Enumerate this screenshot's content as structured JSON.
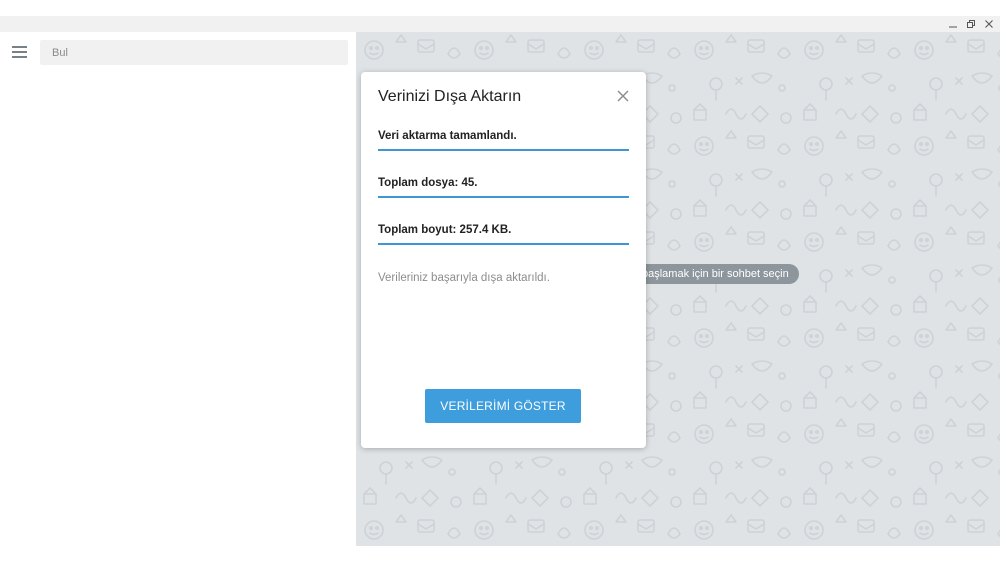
{
  "window": {
    "controls": {
      "minimize_icon": "minimize-icon",
      "maximize_icon": "restore-icon",
      "close_icon": "close-icon"
    }
  },
  "sidebar": {
    "menu_icon": "hamburger-icon",
    "search": {
      "placeholder": "Bul",
      "value": ""
    }
  },
  "chat": {
    "hint": "başlamak için bir sohbet seçin"
  },
  "dialog": {
    "title": "Verinizi Dışa Aktarın",
    "close_icon": "close-icon",
    "fields": [
      "Veri aktarma tamamlandı.",
      "Toplam dosya: 45.",
      "Toplam boyut: 257.4 KB."
    ],
    "status": "Verileriniz başarıyla dışa aktarıldı.",
    "button_label": "VERİLERİMİ GÖSTER"
  },
  "colors": {
    "accent": "#3d9ddd",
    "underline": "#3f96d2",
    "chat_background": "#dfe3e6",
    "hint_pill": "#8d969c"
  }
}
